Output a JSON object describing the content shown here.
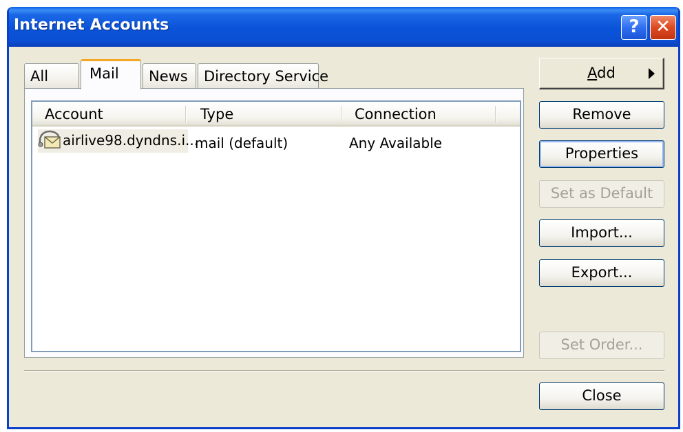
{
  "window": {
    "title": "Internet Accounts",
    "help_glyph": "?",
    "close_glyph": "✕"
  },
  "tabs": [
    {
      "label": "All",
      "active": false
    },
    {
      "label": "Mail",
      "active": true
    },
    {
      "label": "News",
      "active": false
    },
    {
      "label": "Directory Service",
      "active": false
    }
  ],
  "list": {
    "columns": [
      "Account",
      "Type",
      "Connection"
    ],
    "rows": [
      {
        "icon": "mail-account-icon",
        "account": "airlive98.dyndns.i...",
        "type": "mail (default)",
        "connection": "Any Available"
      }
    ]
  },
  "buttons": {
    "add_first": "A",
    "add_rest": "dd",
    "remove": "Remove",
    "properties": "Properties",
    "set_default": "Set as Default",
    "import": "Import...",
    "export": "Export...",
    "set_order": "Set Order...",
    "close": "Close"
  },
  "colors": {
    "titlebar": "#0a53d8",
    "window_bg": "#ece9d8",
    "active_tab_accent": "#f5a623"
  }
}
